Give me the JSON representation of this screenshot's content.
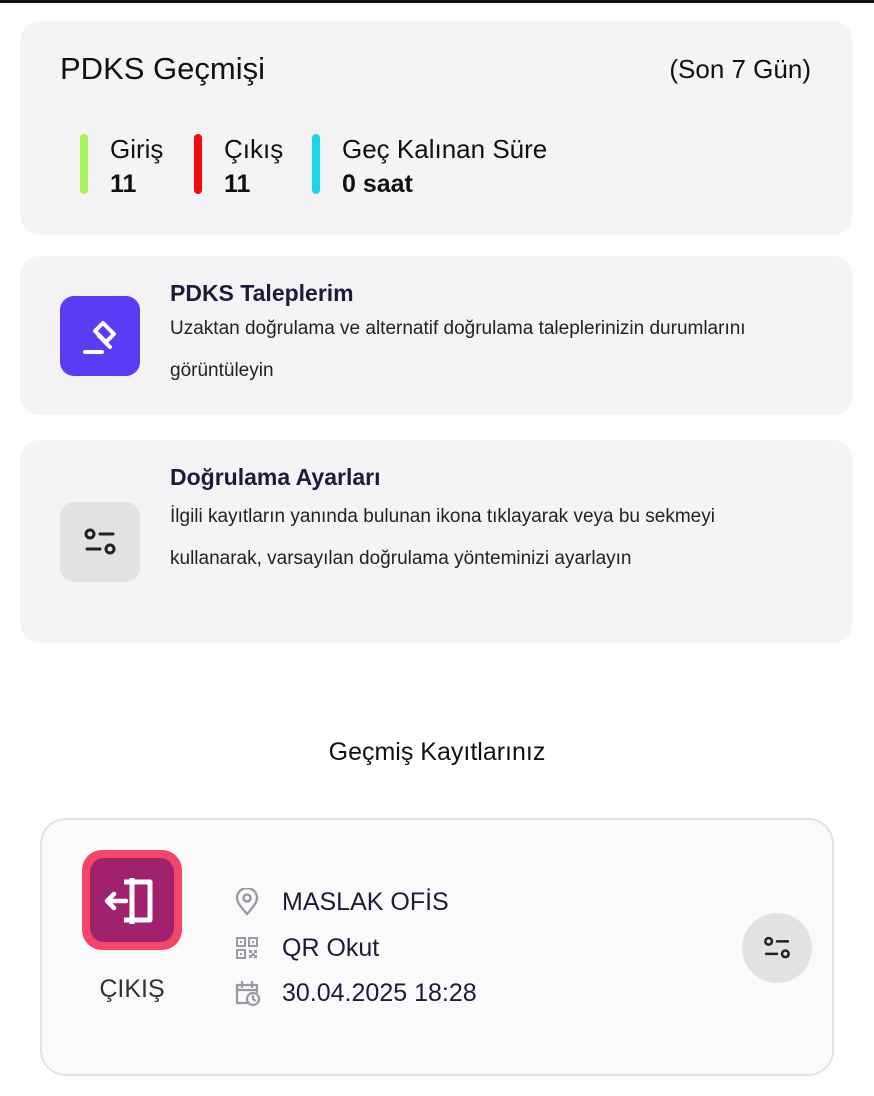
{
  "summary": {
    "title": "PDKS Geçmişi",
    "range": "(Son 7 Gün)",
    "stats": [
      {
        "label": "Giriş",
        "value": "11",
        "color": "#a6f25a"
      },
      {
        "label": "Çıkış",
        "value": "11",
        "color": "#f50a0a"
      },
      {
        "label": "Geç Kalınan Süre",
        "value": "0 saat",
        "color": "#1ad6e8"
      }
    ]
  },
  "requests": {
    "title": "PDKS Taleplerim",
    "description": "Uzaktan doğrulama ve alternatif doğrulama taleplerinizin durumlarını görüntüleyin",
    "icon": "gavel-icon",
    "accent": "#5a3cf5"
  },
  "settings": {
    "title": "Doğrulama Ayarları",
    "description": "İlgili kayıtların yanında bulunan ikona tıklayarak veya bu sekmeyi kullanarak, varsayılan doğrulama yönteminizi ayarlayın",
    "icon": "sliders-icon"
  },
  "history": {
    "heading": "Geçmiş Kayıtlarınız",
    "records": [
      {
        "type": "ÇIKIŞ",
        "location": "MASLAK OFİS",
        "method": "QR Okut",
        "datetime": "30.04.2025 18:28",
        "icon": "exit-door-icon"
      }
    ]
  }
}
